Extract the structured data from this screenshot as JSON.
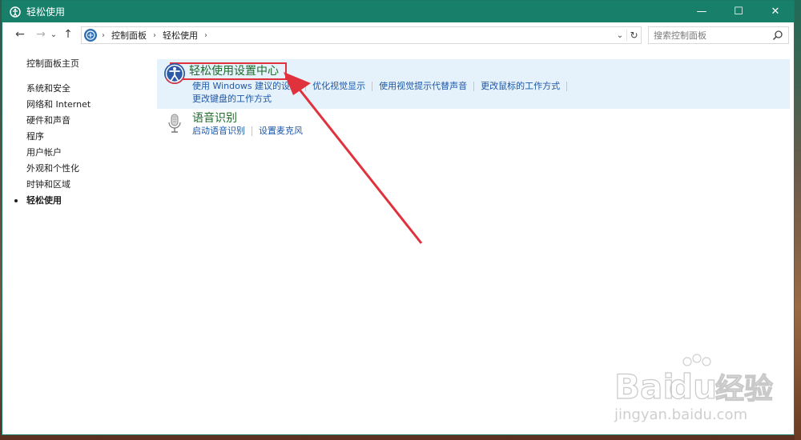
{
  "window": {
    "title": "轻松使用",
    "controls": {
      "minimize": "—",
      "maximize": "☐",
      "close": "✕"
    }
  },
  "nav": {
    "back": "←",
    "forward": "→",
    "recent": "⌄",
    "up": "↑"
  },
  "address": {
    "crumbs": [
      "控制面板",
      "轻松使用"
    ],
    "separator": "›",
    "dropdown": "⌄",
    "refresh": "↻"
  },
  "search": {
    "placeholder": "搜索控制面板"
  },
  "sidebar": {
    "home": "控制面板主页",
    "items": [
      {
        "label": "系统和安全",
        "active": false
      },
      {
        "label": "网络和 Internet",
        "active": false
      },
      {
        "label": "硬件和声音",
        "active": false
      },
      {
        "label": "程序",
        "active": false
      },
      {
        "label": "用户帐户",
        "active": false
      },
      {
        "label": "外观和个性化",
        "active": false
      },
      {
        "label": "时钟和区域",
        "active": false
      },
      {
        "label": "轻松使用",
        "active": true
      }
    ]
  },
  "categories": [
    {
      "title": "轻松使用设置中心",
      "icon": "ease-of-access-icon",
      "links": [
        "使用 Windows 建议的设置",
        "优化视觉显示",
        "使用视觉提示代替声音",
        "更改鼠标的工作方式",
        "更改键盘的工作方式"
      ]
    },
    {
      "title": "语音识别",
      "icon": "microphone-icon",
      "links": [
        "启动语音识别",
        "设置麦克风"
      ]
    }
  ],
  "annotation": {
    "color": "#e0323c"
  },
  "watermark": {
    "brand": "Baidu经验",
    "url": "jingyan.baidu.com"
  },
  "colors": {
    "titlebar": "#177f6a",
    "link": "#1d58a8",
    "category_title": "#1e6b2a",
    "highlight": "#e5f1fb"
  }
}
